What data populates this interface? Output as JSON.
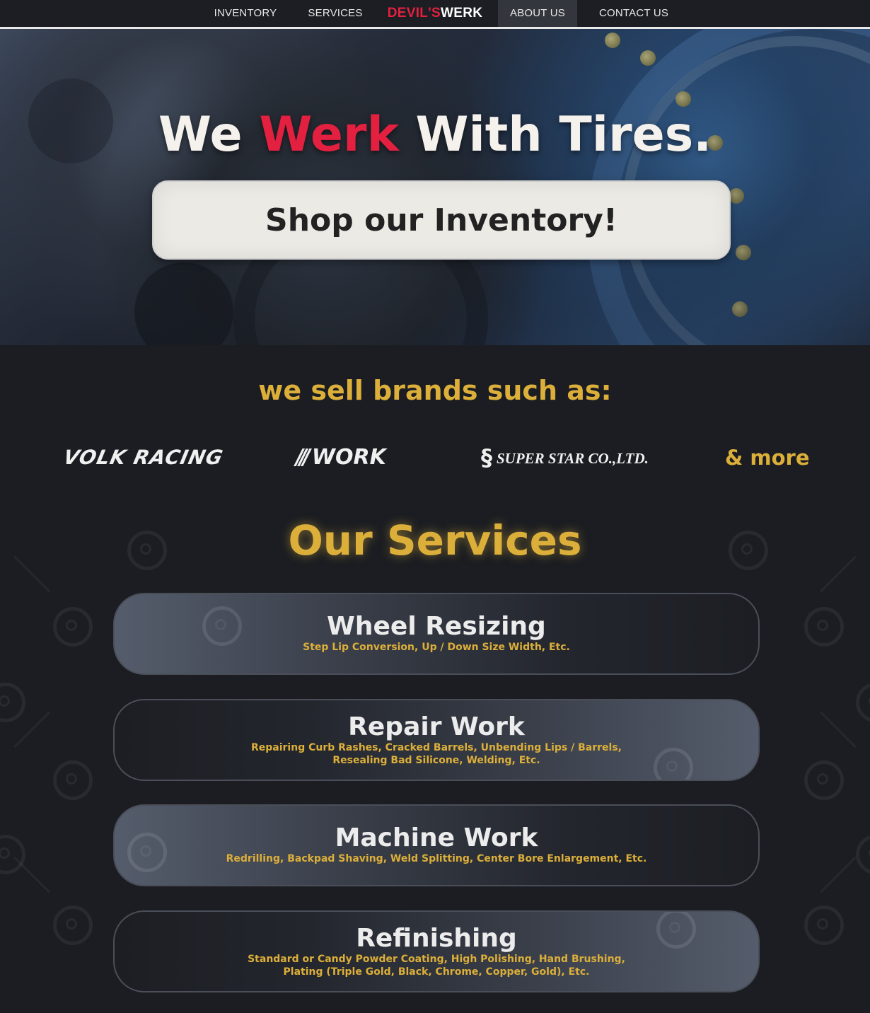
{
  "nav": {
    "items": [
      "INVENTORY",
      "SERVICES",
      "ABOUT US",
      "CONTACT US"
    ],
    "logo_red": "DEVIL'S",
    "logo_white": "WERK",
    "active": "ABOUT US"
  },
  "hero": {
    "title_pre": "We ",
    "title_accent": "Werk",
    "title_post": " With Tires.",
    "shop_button": "Shop our Inventory!"
  },
  "brands": {
    "heading": "we sell brands such as:",
    "items": [
      "VOLK RACING",
      "WORK",
      "SUPER STAR CO.,LTD."
    ],
    "more": "& more"
  },
  "services": {
    "heading": "Our Services",
    "items": [
      {
        "title": "Wheel Resizing",
        "desc": "Step Lip Conversion, Up / Down Size Width, Etc."
      },
      {
        "title": "Repair Work",
        "desc": "Repairing Curb Rashes, Cracked Barrels, Unbending Lips / Barrels,",
        "desc2": "Resealing Bad Silicone, Welding, Etc."
      },
      {
        "title": "Machine Work",
        "desc": "Redrilling, Backpad Shaving, Weld Splitting, Center Bore Enlargement, Etc."
      },
      {
        "title": "Refinishing",
        "desc": "Standard or Candy Powder Coating, High Polishing, Hand Brushing,",
        "desc2": "Plating (Triple Gold, Black, Chrome, Copper, Gold), Etc."
      }
    ]
  },
  "colors": {
    "accent_red": "#e3203f",
    "accent_gold": "#dcaf3a",
    "background": "#1b1d22"
  }
}
